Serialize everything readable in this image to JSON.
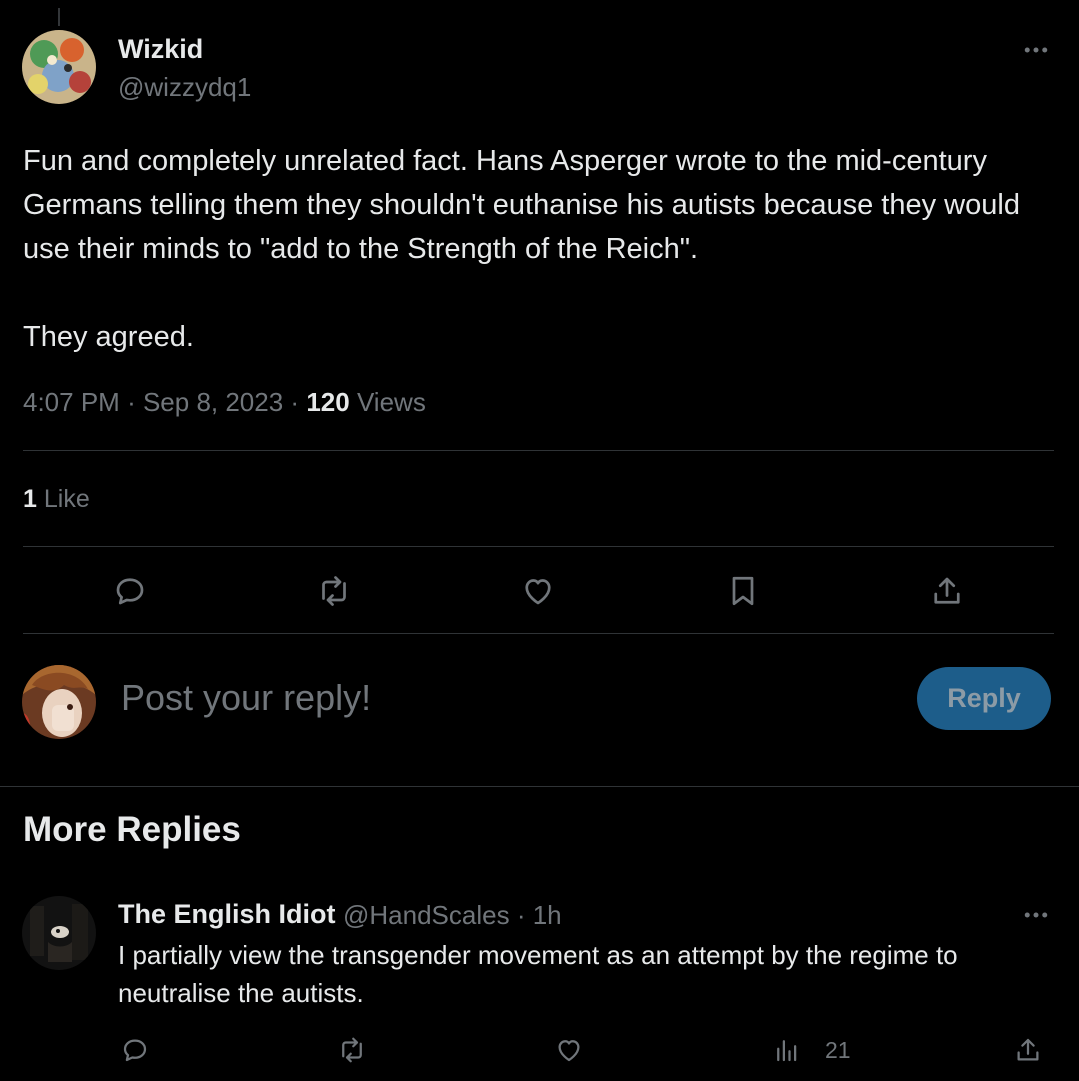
{
  "post": {
    "author_name": "Wizkid",
    "author_handle": "@wizzydq1",
    "text": "Fun and completely unrelated fact. Hans Asperger wrote to the mid-century Germans telling them they shouldn't euthanise his autists because they would use their minds to \"add to the Strength of the Reich\".\n\nThey agreed.",
    "time": "4:07 PM",
    "date": "Sep 8, 2023",
    "views_count": "120",
    "views_label": "Views",
    "like_count": "1",
    "like_label": "Like",
    "icons": [
      "more-icon",
      "reply-icon",
      "repost-icon",
      "like-icon",
      "bookmark-icon",
      "share-icon"
    ]
  },
  "composer": {
    "placeholder": "Post your reply!",
    "button_label": "Reply"
  },
  "more_replies": {
    "title": "More Replies",
    "items": [
      {
        "author_name": "The English Idiot",
        "author_handle": "@HandScales",
        "time": "1h",
        "text": "I partially view the transgender movement as an attempt by the regime to neutralise the autists.",
        "view_count": "21"
      }
    ]
  },
  "colors": {
    "background": "#000000",
    "text": "#e7e9ea",
    "muted": "#71767b",
    "divider": "#2f3336",
    "reply_button": "#1d5d8a"
  }
}
